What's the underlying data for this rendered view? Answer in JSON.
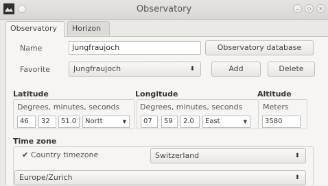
{
  "window": {
    "title": "Observatory",
    "controls": [
      "minimize-icon",
      "maximize-icon",
      "close-icon"
    ]
  },
  "tabs": [
    {
      "label": "Observatory",
      "active": true
    },
    {
      "label": "Horizon",
      "active": false
    }
  ],
  "name_row": {
    "label": "Name",
    "value": "Jungfraujoch",
    "db_button": "Observatory database"
  },
  "favorite_row": {
    "label": "Favorite",
    "selected": "Jungfraujoch",
    "add_button": "Add",
    "delete_button": "Delete"
  },
  "latitude": {
    "title": "Latitude",
    "format_label": "Degrees, minutes, seconds",
    "degrees": "46",
    "minutes": "32",
    "seconds": "51.0",
    "hemisphere": "Nortt"
  },
  "longitude": {
    "title": "Longitude",
    "format_label": "Degrees, minutes, seconds",
    "degrees": "07",
    "minutes": "59",
    "seconds": "2.0",
    "hemisphere": "East"
  },
  "altitude": {
    "title": "Altitude",
    "unit_label": "Meters",
    "value": "3580"
  },
  "timezone": {
    "title": "Time zone",
    "country_checkbox_label": "Country timezone",
    "country_checked": true,
    "country": "Switzerland",
    "zone": "Europe/Zurich"
  },
  "colors": {
    "background": "#ebe9e5",
    "panel": "#f6f5f3"
  }
}
